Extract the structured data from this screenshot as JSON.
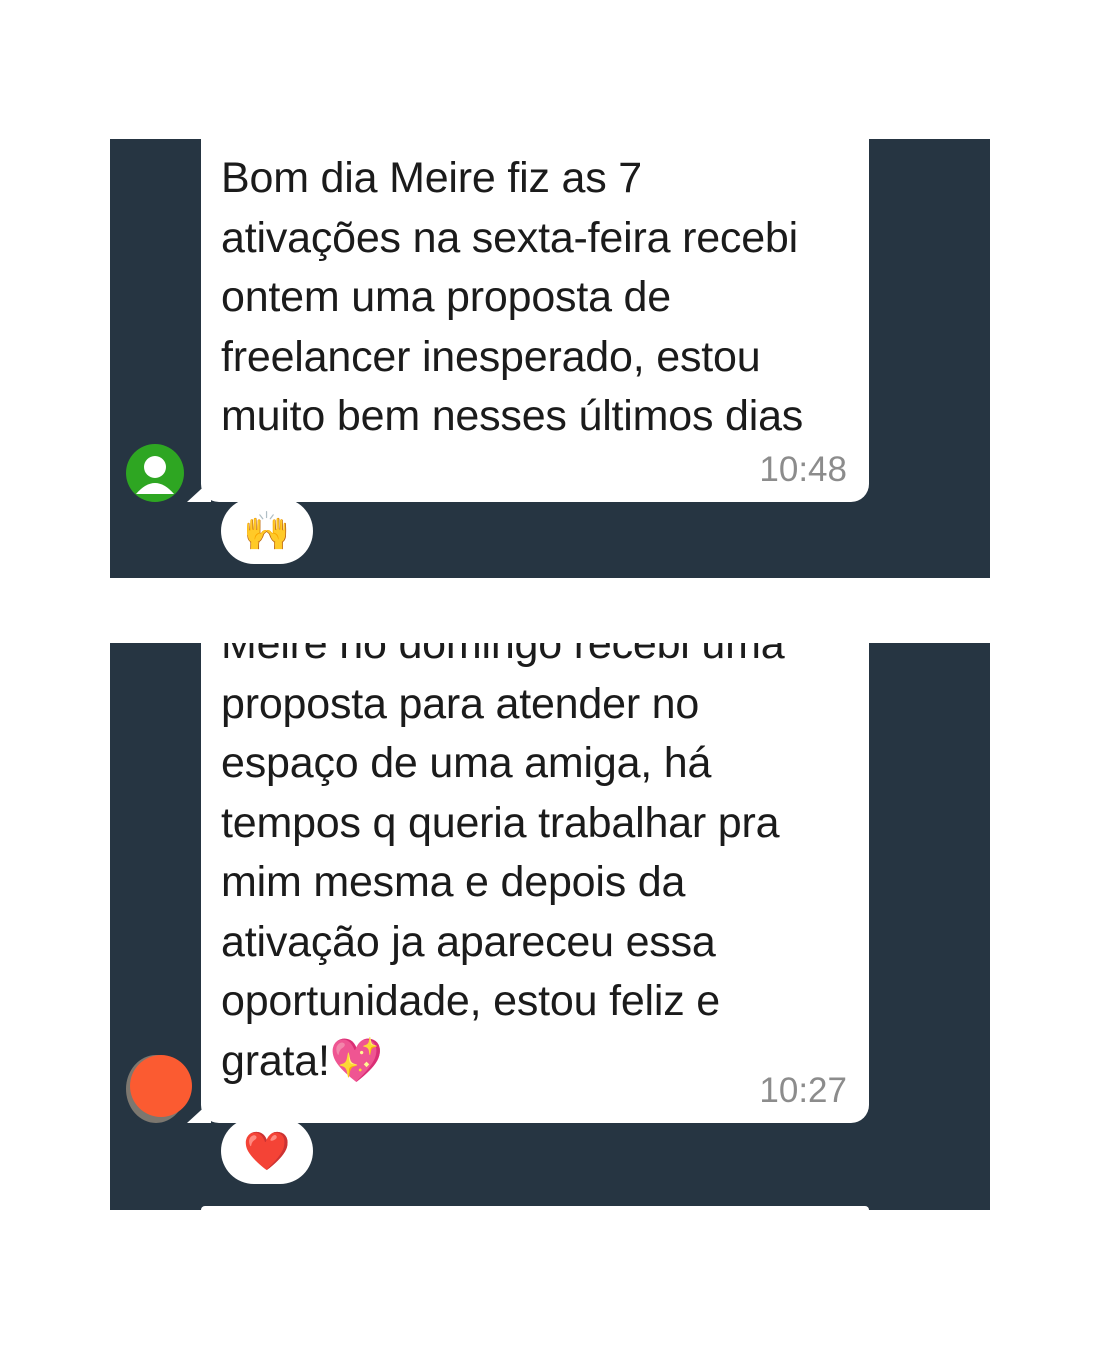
{
  "messages": [
    {
      "text": "Bom dia Meire fiz as 7\nativações na sexta-feira recebi\nontem uma proposta de\nfreelancer inesperado, estou\nmuito bem nesses últimos dias",
      "time": "10:48",
      "reaction": "🙌",
      "avatar": "person-icon"
    },
    {
      "text": "Meire no domingo recebi uma\nproposta para atender no\nespaço de uma amiga, há\ntempos q queria trabalhar pra\nmim mesma e depois da\nativação ja apareceu essa\noportunidade, estou feliz e\ngrata!💖",
      "time": "10:27",
      "reaction": "❤️",
      "avatar": "profile-photo"
    }
  ],
  "colors": {
    "chat_background": "#263542",
    "bubble": "#ffffff",
    "avatar_green": "#2ea622",
    "avatar_orange": "#fb5b31",
    "timestamp": "#8c8c8c"
  }
}
